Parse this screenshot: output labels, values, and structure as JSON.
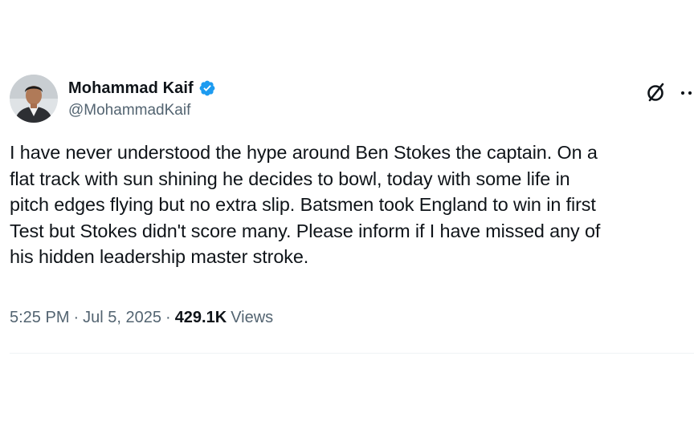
{
  "author": {
    "display_name": "Mohammad Kaif",
    "handle": "@MohammadKaif",
    "verified": true
  },
  "tweet": {
    "text": "I have never understood the hype around Ben Stokes the captain. On a\nflat track with sun shining he decides to bowl, today with some life in\npitch edges flying but no extra slip. Batsmen took England to win in first\nTest but Stokes didn't score many. Please inform if I have missed any of\nhis hidden leadership master stroke."
  },
  "meta": {
    "time": "5:25 PM",
    "date": "Jul 5, 2025",
    "separator": "·",
    "views_count": "429.1K",
    "views_label": "Views"
  },
  "icons": {
    "verified": "verified-badge-icon",
    "grok": "grok-icon",
    "more": "more-options-icon"
  },
  "colors": {
    "verified_blue": "#1d9bf0",
    "text_primary": "#0f1419",
    "text_secondary": "#536471"
  }
}
